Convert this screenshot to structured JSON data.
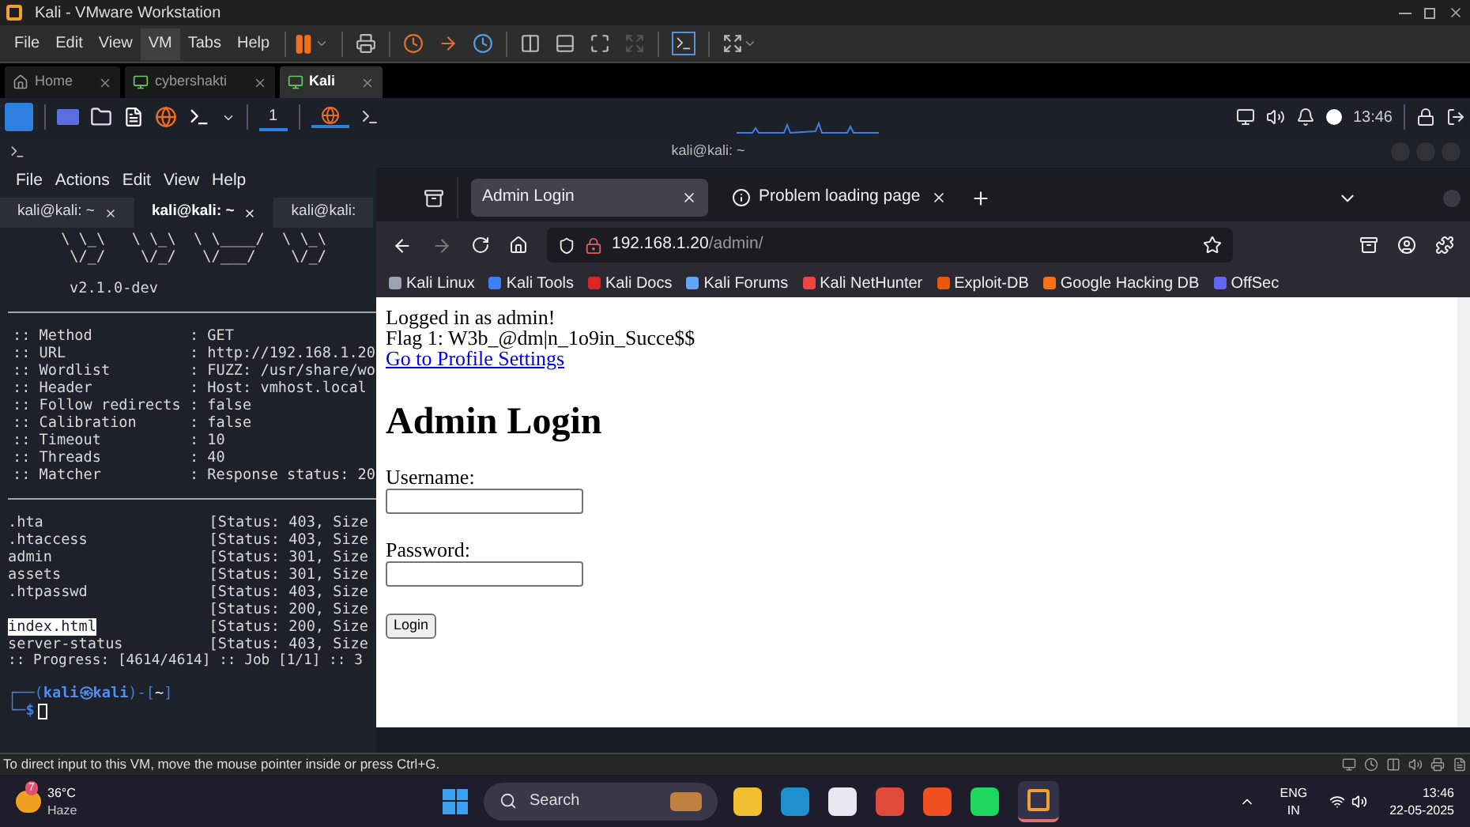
{
  "vmware": {
    "title": "Kali - VMware Workstation",
    "menu": [
      {
        "label": "File",
        "selected": false
      },
      {
        "label": "Edit",
        "selected": false
      },
      {
        "label": "View",
        "selected": false
      },
      {
        "label": "VM",
        "selected": true
      },
      {
        "label": "Tabs",
        "selected": false
      },
      {
        "label": "Help",
        "selected": false
      }
    ],
    "tabs": [
      {
        "label": "Home",
        "kind": "home",
        "selected": false
      },
      {
        "label": "cybershakti",
        "kind": "vm",
        "selected": false
      },
      {
        "label": "Kali",
        "kind": "vm",
        "selected": true
      }
    ],
    "status_text": "To direct input to this VM, move the mouse pointer inside or press Ctrl+G."
  },
  "kali_panel": {
    "workspace": "1",
    "clock": "13:46"
  },
  "terminal": {
    "title": "kali@kali: ~",
    "menu": [
      "File",
      "Actions",
      "Edit",
      "View",
      "Help"
    ],
    "tabs": [
      {
        "label": "kali@kali: ~",
        "selected": false,
        "closable": true
      },
      {
        "label": "kali@kali: ~",
        "selected": true,
        "closable": true
      },
      {
        "label": "kali@kali:",
        "selected": false,
        "closable": false
      }
    ],
    "banner": [
      "      \\ \\_\\   \\ \\_\\  \\ \\____/  \\ \\_\\",
      "       \\/_/    \\/_/   \\/___/    \\/_/"
    ],
    "version": "v2.1.0-dev",
    "settings": [
      ":: Method           : GET",
      ":: URL              : http://192.168.1.20",
      ":: Wordlist         : FUZZ: /usr/share/wo",
      ":: Header           : Host: vmhost.local",
      ":: Follow redirects : false",
      ":: Calibration      : false",
      ":: Timeout          : 10",
      ":: Threads          : 40",
      ":: Matcher          : Response status: 20"
    ],
    "results": [
      {
        "name": ".hta",
        "status": "[Status: 403, Size",
        "selected": false
      },
      {
        "name": ".htaccess",
        "status": "[Status: 403, Size",
        "selected": false
      },
      {
        "name": "admin",
        "status": "[Status: 301, Size",
        "selected": false
      },
      {
        "name": "assets",
        "status": "[Status: 301, Size",
        "selected": false
      },
      {
        "name": ".htpasswd",
        "status": "[Status: 403, Size",
        "selected": false
      },
      {
        "status": "[Status: 200, Size",
        "selected": false
      },
      {
        "name": "index.html",
        "status": "[Status: 200, Size",
        "selected": true
      },
      {
        "name": "server-status",
        "status": "[Status: 403, Size",
        "selected": false
      }
    ],
    "progress": ":: Progress: [4614/4614] :: Job [1/1] :: 3",
    "prompt": {
      "open": "┌──(",
      "user": "kali㉿kali",
      "mid": ")-[",
      "dir": "~",
      "close": "]",
      "corner": "└─",
      "symbol": "$"
    }
  },
  "browser": {
    "tabs": [
      {
        "title": "Admin Login",
        "selected": true
      },
      {
        "title": "Problem loading page",
        "selected": false
      }
    ],
    "url": {
      "host": "192.168.1.20",
      "path": "/admin/"
    },
    "bookmarks": [
      {
        "label": "Kali Linux",
        "color": "#9ca3af"
      },
      {
        "label": "Kali Tools",
        "color": "#3b82f6"
      },
      {
        "label": "Kali Docs",
        "color": "#dc2626"
      },
      {
        "label": "Kali Forums",
        "color": "#60a5fa"
      },
      {
        "label": "Kali NetHunter",
        "color": "#ef4444"
      },
      {
        "label": "Exploit-DB",
        "color": "#ea580c"
      },
      {
        "label": "Google Hacking DB",
        "color": "#f97316"
      },
      {
        "label": "OffSec",
        "color": "#6366f1"
      }
    ],
    "page": {
      "messages": [
        "Logged in as admin!",
        "Flag 1: W3b_@dm|n_1o9in_Succe$$"
      ],
      "link": "Go to Profile Settings",
      "heading": "Admin Login",
      "fields": [
        {
          "label": "Username:"
        },
        {
          "label": "Password:"
        }
      ],
      "button": "Login"
    }
  },
  "taskbar": {
    "weather": {
      "badge": "7",
      "temp": "36°C",
      "condition": "Haze"
    },
    "search": {
      "placeholder": "Search"
    },
    "language": [
      "ENG",
      "IN"
    ],
    "time": "13:46",
    "date": "22-05-2025"
  }
}
